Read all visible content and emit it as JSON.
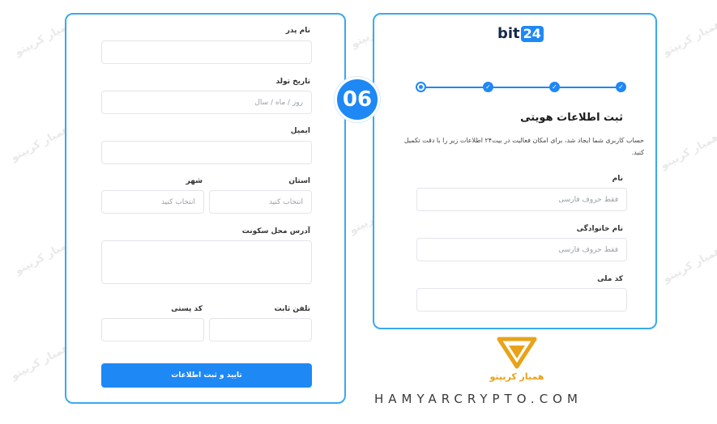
{
  "watermark": "همیار کریپتو",
  "step_badge": "06",
  "left_form": {
    "father_name": {
      "label": "نام پدر",
      "value": ""
    },
    "birth_date": {
      "label": "تاریخ تولد",
      "placeholder": "روز / ماه / سال"
    },
    "email": {
      "label": "ایمیل",
      "value": ""
    },
    "province": {
      "label": "استان",
      "placeholder": "انتخاب کنید"
    },
    "city": {
      "label": "شهر",
      "placeholder": "انتخاب کنید"
    },
    "address": {
      "label": "آدرس محل سکونت",
      "value": ""
    },
    "landline": {
      "label": "تلفن ثابت",
      "value": ""
    },
    "postal_code": {
      "label": "کد پستی",
      "value": ""
    },
    "submit_label": "تایید و ثبت اطلاعات"
  },
  "right_form": {
    "logo_text": "bit",
    "logo_box": "24",
    "stepper": {
      "total": 4,
      "current": 4,
      "check_icon": "✓"
    },
    "title": "ثبت اطلاعات هویتی",
    "description": "حساب کاربری شما ایجاد شد، برای امکان فعالیت در بیت۲۴ اطلاعات زیر را با دقت تکمیل کنید.",
    "first_name": {
      "label": "نام",
      "placeholder": "فقط حروف فارسی"
    },
    "last_name": {
      "label": "نام خانوادگی",
      "placeholder": "فقط حروف فارسی"
    },
    "national_code": {
      "label": "کد ملی",
      "value": ""
    }
  },
  "brand": {
    "name": "همیار کریپتو",
    "site": "HAMYARCRYPTO.COM",
    "colors": {
      "gold": "#e8a31a",
      "accent": "#1e88f5",
      "border": "#3aa9ee"
    }
  }
}
